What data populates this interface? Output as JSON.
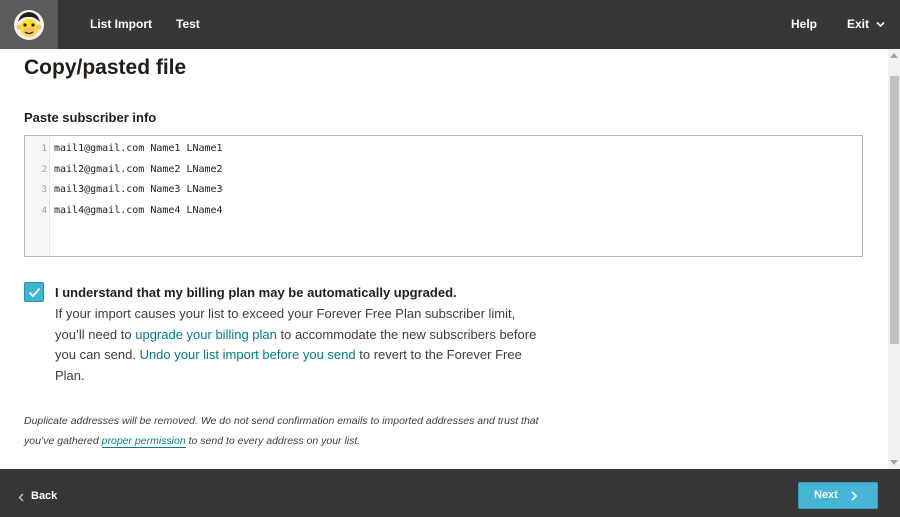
{
  "topbar": {
    "logo": "mailchimp-freddie-logo",
    "nav": [
      "List Import",
      "Test"
    ],
    "help_label": "Help",
    "exit_label": "Exit"
  },
  "main": {
    "title": "Copy/pasted file",
    "paste_label": "Paste subscriber info",
    "editor_lines": [
      {
        "num": "1",
        "text": "mail1@gmail.com Name1 LName1"
      },
      {
        "num": "2",
        "text": "mail2@gmail.com Name2 LName2"
      },
      {
        "num": "3",
        "text": "mail3@gmail.com Name3 LName3"
      },
      {
        "num": "4",
        "text": "mail4@gmail.com Name4 LName4"
      }
    ],
    "billing_checkbox": {
      "checked": true,
      "label": "I understand that my billing plan may be automatically upgraded."
    },
    "notice": {
      "part1": "If your import causes your list to exceed your Forever Free Plan subscriber limit, you’ll need to ",
      "link1": "upgrade your billing plan",
      "part2": " to accommodate the new subscribers before you can send. ",
      "link2": "Undo your list import before you send",
      "part3": " to revert to the Forever Free Plan."
    },
    "footnote": {
      "part1": "Duplicate addresses will be removed. We do not send confirmation emails to imported addresses and trust that you’ve gathered ",
      "link": "proper permission",
      "part2": " to send to every address on your list."
    }
  },
  "bottombar": {
    "back_label": "Back",
    "next_label": "Next"
  },
  "colors": {
    "topbar_bg": "#373737",
    "accent": "#46b4d5",
    "link": "#007c89"
  }
}
